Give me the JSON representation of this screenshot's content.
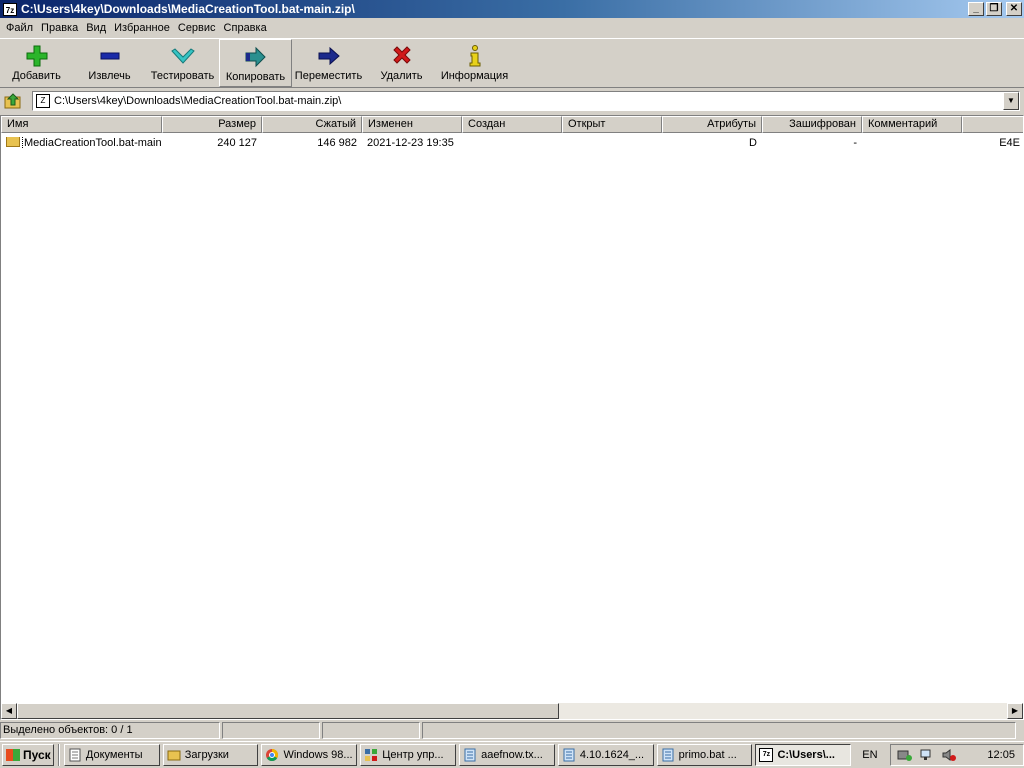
{
  "window": {
    "title": "C:\\Users\\4key\\Downloads\\MediaCreationTool.bat-main.zip\\",
    "app_icon_text": "7z"
  },
  "menu": [
    "Файл",
    "Правка",
    "Вид",
    "Избранное",
    "Сервис",
    "Справка"
  ],
  "toolbar": {
    "add": "Добавить",
    "extract": "Извлечь",
    "test": "Тестировать",
    "copy": "Копировать",
    "move": "Переместить",
    "delete": "Удалить",
    "info": "Информация"
  },
  "address": {
    "path": "C:\\Users\\4key\\Downloads\\MediaCreationTool.bat-main.zip\\"
  },
  "columns": [
    "Имя",
    "Размер",
    "Сжатый",
    "Изменен",
    "Создан",
    "Открыт",
    "Атрибуты",
    "Зашифрован",
    "Комментарий"
  ],
  "rows": [
    {
      "name": "MediaCreationTool.bat-main",
      "size": "240 127",
      "packed": "146 982",
      "modified": "2021-12-23 19:35",
      "created": "",
      "accessed": "",
      "attributes": "D",
      "encrypted": "-",
      "comment": "",
      "overflow": "E4E"
    }
  ],
  "status": {
    "selected": "Выделено объектов: 0 / 1"
  },
  "taskbar": {
    "start": "Пуск",
    "tasks": [
      "Документы",
      "Загрузки",
      "Windows 98...",
      "Центр упр...",
      "aaefnow.tx...",
      "4.10.1624_...",
      "primo.bat ...",
      "C:\\Users\\..."
    ],
    "language": "EN",
    "clock": "12:05"
  },
  "icons": {
    "add": "plus-icon",
    "extract": "minus-icon",
    "test": "check-icon",
    "copy": "copy-arrow-icon",
    "move": "move-arrow-icon",
    "delete": "delete-x-icon",
    "info": "info-icon"
  },
  "colors": {
    "title_start": "#0a246a",
    "title_end": "#a6caf0",
    "add_green": "#2bb52b",
    "extract_blue": "#1a2aa8",
    "delete_red": "#d11a1a",
    "move_navy": "#1c2a8c",
    "copy_teal": "#2a8f8f"
  }
}
